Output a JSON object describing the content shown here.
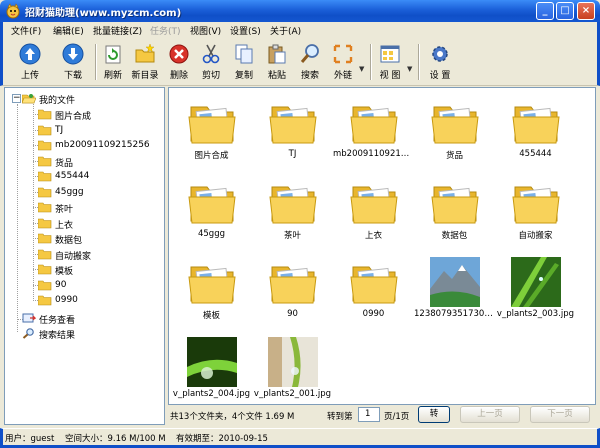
{
  "window": {
    "title": "招财猫助理(www.myzcm.com)",
    "min_glyph": "_",
    "max_glyph": "□",
    "close_glyph": "×"
  },
  "menu": [
    {
      "label": "文件(F)",
      "enabled": true
    },
    {
      "label": "编辑(E)",
      "enabled": true
    },
    {
      "label": "批量链接(Z)",
      "enabled": true
    },
    {
      "label": "任务(T)",
      "enabled": false
    },
    {
      "label": "视图(V)",
      "enabled": true
    },
    {
      "label": "设置(S)",
      "enabled": true
    },
    {
      "label": "关于(A)",
      "enabled": true
    }
  ],
  "toolbar": {
    "upload": "上传",
    "download": "下载",
    "refresh": "刷新",
    "new_folder": "新目录",
    "delete": "删除",
    "cut": "剪切",
    "copy": "复制",
    "paste": "粘贴",
    "search": "搜索",
    "external_link": "外链",
    "view": "视 图",
    "settings": "设 置",
    "dropdown_glyph": "▼"
  },
  "tree": {
    "root": "我的文件",
    "expander": "−",
    "folders": [
      "图片合成",
      "TJ",
      "mb20091109215256",
      "货品",
      "455444",
      "45ggg",
      "茶叶",
      "上衣",
      "数据包",
      "自动搬家",
      "模板",
      "90",
      "0990"
    ],
    "tasks": "任务查看",
    "search_results": "搜索结果"
  },
  "files": [
    {
      "name": "图片合成",
      "kind": "folder"
    },
    {
      "name": "TJ",
      "kind": "folder"
    },
    {
      "name": "mb20091109215256",
      "kind": "folder"
    },
    {
      "name": "货品",
      "kind": "folder"
    },
    {
      "name": "455444",
      "kind": "folder"
    },
    {
      "name": "45ggg",
      "kind": "folder"
    },
    {
      "name": "茶叶",
      "kind": "folder"
    },
    {
      "name": "上衣",
      "kind": "folder"
    },
    {
      "name": "数据包",
      "kind": "folder"
    },
    {
      "name": "自动搬家",
      "kind": "folder"
    },
    {
      "name": "模板",
      "kind": "folder"
    },
    {
      "name": "90",
      "kind": "folder"
    },
    {
      "name": "0990",
      "kind": "folder"
    },
    {
      "name": "12380793517304...",
      "kind": "image-mountain"
    },
    {
      "name": "v_plants2_003.jpg",
      "kind": "image-grass"
    },
    {
      "name": "v_plants2_004.jpg",
      "kind": "image-drop"
    },
    {
      "name": "v_plants2_001.jpg",
      "kind": "image-leaf"
    }
  ],
  "pager": {
    "summary": "共13个文件夹，4个文件 1.69 M",
    "goto_label": "转到第",
    "page_value": "1",
    "page_total": "页/1页",
    "go_button": "转",
    "prev_button": "上一页",
    "next_button": "下一页"
  },
  "status": {
    "user": "用户：guest",
    "space": "空间大小：9.16 M/100 M",
    "expiry": "有效期至：2010-09-15"
  },
  "colors": {
    "titlebar": "#0f4fc8",
    "folder": "#f5c842",
    "panel_border": "#7f9db9"
  }
}
